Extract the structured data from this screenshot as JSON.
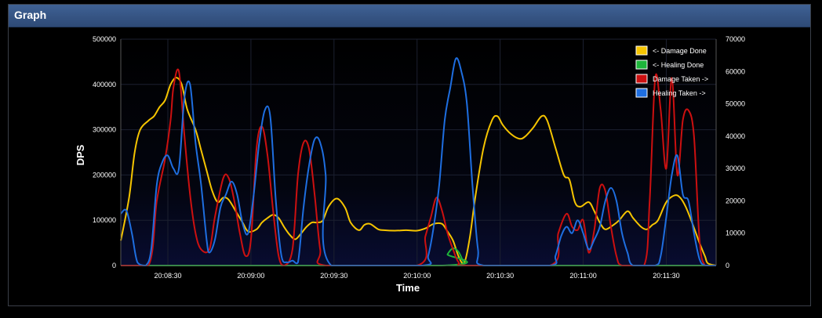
{
  "window": {
    "title": "Graph"
  },
  "chart_data": {
    "type": "line",
    "xlabel": "Time",
    "ylabel": "DPS",
    "ylim": [
      0,
      500000
    ],
    "y2lim": [
      0,
      70000
    ],
    "yticks": [
      0,
      100000,
      200000,
      300000,
      400000,
      500000
    ],
    "y2ticks": [
      0,
      10000,
      20000,
      30000,
      40000,
      50000,
      60000,
      70000
    ],
    "xlim": [
      "20:08:13",
      "20:11:48"
    ],
    "xticks": [
      "20:08:30",
      "20:09:00",
      "20:09:30",
      "20:10:00",
      "20:10:30",
      "20:11:00",
      "20:11:30"
    ],
    "grid": true,
    "legend_position": "top-right",
    "series": [
      {
        "name": "<- Damage Done",
        "axis": "left",
        "color": "#f5c400",
        "points": [
          [
            "20:08:13",
            55000
          ],
          [
            "20:08:16",
            150000
          ],
          [
            "20:08:18",
            250000
          ],
          [
            "20:08:20",
            300000
          ],
          [
            "20:08:23",
            320000
          ],
          [
            "20:08:25",
            330000
          ],
          [
            "20:08:27",
            350000
          ],
          [
            "20:08:29",
            365000
          ],
          [
            "20:08:31",
            400000
          ],
          [
            "20:08:33",
            415000
          ],
          [
            "20:08:35",
            400000
          ],
          [
            "20:08:37",
            345000
          ],
          [
            "20:08:40",
            300000
          ],
          [
            "20:08:42",
            255000
          ],
          [
            "20:08:44",
            210000
          ],
          [
            "20:08:46",
            165000
          ],
          [
            "20:08:48",
            140000
          ],
          [
            "20:08:50",
            150000
          ],
          [
            "20:08:52",
            145000
          ],
          [
            "20:08:55",
            115000
          ],
          [
            "20:08:57",
            95000
          ],
          [
            "20:08:59",
            75000
          ],
          [
            "20:09:02",
            80000
          ],
          [
            "20:09:04",
            95000
          ],
          [
            "20:09:06",
            105000
          ],
          [
            "20:09:08",
            112000
          ],
          [
            "20:09:10",
            105000
          ],
          [
            "20:09:12",
            85000
          ],
          [
            "20:09:14",
            68000
          ],
          [
            "20:09:16",
            58000
          ],
          [
            "20:09:18",
            70000
          ],
          [
            "20:09:20",
            85000
          ],
          [
            "20:09:22",
            95000
          ],
          [
            "20:09:24",
            95000
          ],
          [
            "20:09:26",
            100000
          ],
          [
            "20:09:28",
            130000
          ],
          [
            "20:09:31",
            148000
          ],
          [
            "20:09:34",
            128000
          ],
          [
            "20:09:36",
            95000
          ],
          [
            "20:09:39",
            78000
          ],
          [
            "20:09:41",
            90000
          ],
          [
            "20:09:43",
            92000
          ],
          [
            "20:09:46",
            80000
          ],
          [
            "20:09:48",
            78000
          ],
          [
            "20:09:52",
            77000
          ],
          [
            "20:09:56",
            78000
          ],
          [
            "20:10:00",
            77000
          ],
          [
            "20:10:03",
            82000
          ],
          [
            "20:10:06",
            92000
          ],
          [
            "20:10:09",
            92000
          ],
          [
            "20:10:11",
            75000
          ],
          [
            "20:10:13",
            55000
          ],
          [
            "20:10:15",
            20000
          ],
          [
            "20:10:17",
            5000
          ],
          [
            "20:10:19",
            60000
          ],
          [
            "20:10:21",
            150000
          ],
          [
            "20:10:24",
            260000
          ],
          [
            "20:10:27",
            320000
          ],
          [
            "20:10:29",
            330000
          ],
          [
            "20:10:31",
            310000
          ],
          [
            "20:10:34",
            290000
          ],
          [
            "20:10:37",
            280000
          ],
          [
            "20:10:39",
            285000
          ],
          [
            "20:10:42",
            305000
          ],
          [
            "20:10:45",
            330000
          ],
          [
            "20:10:47",
            320000
          ],
          [
            "20:10:50",
            260000
          ],
          [
            "20:10:53",
            200000
          ],
          [
            "20:10:55",
            190000
          ],
          [
            "20:10:57",
            140000
          ],
          [
            "20:10:59",
            130000
          ],
          [
            "20:11:02",
            140000
          ],
          [
            "20:11:04",
            120000
          ],
          [
            "20:11:06",
            95000
          ],
          [
            "20:11:08",
            80000
          ],
          [
            "20:11:11",
            90000
          ],
          [
            "20:11:13",
            100000
          ],
          [
            "20:11:16",
            120000
          ],
          [
            "20:11:18",
            105000
          ],
          [
            "20:11:21",
            85000
          ],
          [
            "20:11:23",
            80000
          ],
          [
            "20:11:25",
            90000
          ],
          [
            "20:11:27",
            100000
          ],
          [
            "20:11:30",
            140000
          ],
          [
            "20:11:33",
            155000
          ],
          [
            "20:11:35",
            150000
          ],
          [
            "20:11:37",
            130000
          ],
          [
            "20:11:39",
            100000
          ],
          [
            "20:11:42",
            50000
          ],
          [
            "20:11:44",
            20000
          ],
          [
            "20:11:45",
            5000
          ],
          [
            "20:11:48",
            0
          ]
        ]
      },
      {
        "name": "<- Healing Done",
        "axis": "left",
        "color": "#1db53a",
        "points": [
          [
            "20:08:13",
            0
          ],
          [
            "20:10:09",
            0
          ],
          [
            "20:10:11",
            25000
          ],
          [
            "20:10:13",
            38000
          ],
          [
            "20:10:15",
            30000
          ],
          [
            "20:10:17",
            5000
          ],
          [
            "20:10:18",
            0
          ],
          [
            "20:11:48",
            0
          ]
        ]
      },
      {
        "name": "Damage Taken ->",
        "axis": "right",
        "color": "#cc1010",
        "points": [
          [
            "20:08:13",
            0
          ],
          [
            "20:08:23",
            0
          ],
          [
            "20:08:26",
            20000
          ],
          [
            "20:08:29",
            33000
          ],
          [
            "20:08:31",
            45000
          ],
          [
            "20:08:32",
            55000
          ],
          [
            "20:08:34",
            60000
          ],
          [
            "20:08:36",
            40000
          ],
          [
            "20:08:38",
            22000
          ],
          [
            "20:08:40",
            10000
          ],
          [
            "20:08:42",
            5000
          ],
          [
            "20:08:45",
            5000
          ],
          [
            "20:08:47",
            15000
          ],
          [
            "20:08:50",
            27000
          ],
          [
            "20:08:52",
            27000
          ],
          [
            "20:08:54",
            20000
          ],
          [
            "20:08:56",
            10000
          ],
          [
            "20:08:58",
            3000
          ],
          [
            "20:09:00",
            8000
          ],
          [
            "20:09:02",
            36000
          ],
          [
            "20:09:04",
            43000
          ],
          [
            "20:09:06",
            34000
          ],
          [
            "20:09:08",
            17000
          ],
          [
            "20:09:10",
            3000
          ],
          [
            "20:09:12",
            0
          ],
          [
            "20:09:15",
            5000
          ],
          [
            "20:09:17",
            28000
          ],
          [
            "20:09:19",
            38000
          ],
          [
            "20:09:21",
            36000
          ],
          [
            "20:09:23",
            22000
          ],
          [
            "20:09:25",
            5000
          ],
          [
            "20:09:27",
            0
          ],
          [
            "20:10:00",
            0
          ],
          [
            "20:10:03",
            9000
          ],
          [
            "20:10:05",
            15000
          ],
          [
            "20:10:07",
            21000
          ],
          [
            "20:10:09",
            17000
          ],
          [
            "20:10:11",
            10000
          ],
          [
            "20:10:13",
            5000
          ],
          [
            "20:10:15",
            1000
          ],
          [
            "20:10:18",
            0
          ],
          [
            "20:10:48",
            0
          ],
          [
            "20:10:51",
            10000
          ],
          [
            "20:10:54",
            16000
          ],
          [
            "20:10:56",
            12000
          ],
          [
            "20:10:58",
            11000
          ],
          [
            "20:11:00",
            14000
          ],
          [
            "20:11:02",
            4000
          ],
          [
            "20:11:04",
            11000
          ],
          [
            "20:11:06",
            24000
          ],
          [
            "20:11:08",
            23000
          ],
          [
            "20:11:10",
            12000
          ],
          [
            "20:11:12",
            3000
          ],
          [
            "20:11:14",
            0
          ],
          [
            "20:11:22",
            0
          ],
          [
            "20:11:24",
            20000
          ],
          [
            "20:11:26",
            58000
          ],
          [
            "20:11:28",
            48000
          ],
          [
            "20:11:30",
            30000
          ],
          [
            "20:11:32",
            58000
          ],
          [
            "20:11:34",
            28000
          ],
          [
            "20:11:36",
            45000
          ],
          [
            "20:11:38",
            48000
          ],
          [
            "20:11:40",
            40000
          ],
          [
            "20:11:42",
            8000
          ],
          [
            "20:11:44",
            0
          ],
          [
            "20:11:48",
            0
          ]
        ]
      },
      {
        "name": "Healing Taken ->",
        "axis": "right",
        "color": "#1e6ee0",
        "points": [
          [
            "20:08:13",
            16000
          ],
          [
            "20:08:15",
            17000
          ],
          [
            "20:08:17",
            10000
          ],
          [
            "20:08:19",
            1000
          ],
          [
            "20:08:22",
            0
          ],
          [
            "20:08:24",
            5000
          ],
          [
            "20:08:26",
            25000
          ],
          [
            "20:08:28",
            32000
          ],
          [
            "20:08:30",
            34000
          ],
          [
            "20:08:32",
            30000
          ],
          [
            "20:08:34",
            30000
          ],
          [
            "20:08:36",
            52000
          ],
          [
            "20:08:38",
            56000
          ],
          [
            "20:08:40",
            38000
          ],
          [
            "20:08:42",
            25000
          ],
          [
            "20:08:44",
            8000
          ],
          [
            "20:08:45",
            4000
          ],
          [
            "20:08:47",
            8000
          ],
          [
            "20:08:49",
            18000
          ],
          [
            "20:08:51",
            22000
          ],
          [
            "20:08:53",
            26000
          ],
          [
            "20:08:55",
            22000
          ],
          [
            "20:08:57",
            13000
          ],
          [
            "20:08:59",
            10000
          ],
          [
            "20:09:01",
            22000
          ],
          [
            "20:09:03",
            38000
          ],
          [
            "20:09:05",
            48000
          ],
          [
            "20:09:07",
            46000
          ],
          [
            "20:09:09",
            20000
          ],
          [
            "20:09:11",
            3000
          ],
          [
            "20:09:13",
            1000
          ],
          [
            "20:09:15",
            1500
          ],
          [
            "20:09:17",
            1000
          ],
          [
            "20:09:19",
            18000
          ],
          [
            "20:09:21",
            31000
          ],
          [
            "20:09:23",
            39000
          ],
          [
            "20:09:25",
            38000
          ],
          [
            "20:09:27",
            28000
          ],
          [
            "20:09:29",
            0
          ],
          [
            "20:10:02",
            0
          ],
          [
            "20:10:04",
            3000
          ],
          [
            "20:10:06",
            12000
          ],
          [
            "20:10:08",
            25000
          ],
          [
            "20:10:10",
            45000
          ],
          [
            "20:10:12",
            55000
          ],
          [
            "20:10:14",
            64000
          ],
          [
            "20:10:16",
            60000
          ],
          [
            "20:10:18",
            50000
          ],
          [
            "20:10:20",
            25000
          ],
          [
            "20:10:22",
            5000
          ],
          [
            "20:10:24",
            0
          ],
          [
            "20:10:48",
            0
          ],
          [
            "20:10:50",
            3000
          ],
          [
            "20:10:52",
            9000
          ],
          [
            "20:10:54",
            12000
          ],
          [
            "20:10:56",
            10000
          ],
          [
            "20:10:58",
            14000
          ],
          [
            "20:11:00",
            10000
          ],
          [
            "20:11:02",
            5000
          ],
          [
            "20:11:04",
            8000
          ],
          [
            "20:11:06",
            12000
          ],
          [
            "20:11:08",
            20000
          ],
          [
            "20:11:10",
            24000
          ],
          [
            "20:11:12",
            20000
          ],
          [
            "20:11:14",
            10000
          ],
          [
            "20:11:16",
            4000
          ],
          [
            "20:11:18",
            0
          ],
          [
            "20:11:26",
            0
          ],
          [
            "20:11:28",
            3000
          ],
          [
            "20:11:30",
            15000
          ],
          [
            "20:11:32",
            28000
          ],
          [
            "20:11:34",
            34000
          ],
          [
            "20:11:36",
            22000
          ],
          [
            "20:11:38",
            20000
          ],
          [
            "20:11:40",
            10000
          ],
          [
            "20:11:42",
            2000
          ],
          [
            "20:11:44",
            0
          ],
          [
            "20:11:48",
            0
          ]
        ]
      }
    ]
  }
}
